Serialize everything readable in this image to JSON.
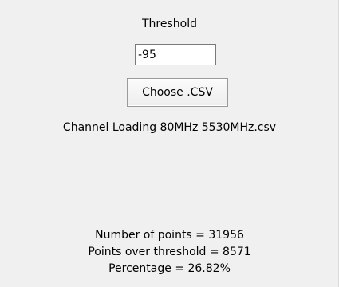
{
  "threshold": {
    "label": "Threshold",
    "value": "-95"
  },
  "controls": {
    "choose_csv_label": "Choose .CSV"
  },
  "file": {
    "name": "Channel Loading 80MHz 5530MHz.csv"
  },
  "results": {
    "points": "Number of points = 31956",
    "over": "Points over threshold = 8571",
    "percentage": "Percentage = 26.82%"
  }
}
